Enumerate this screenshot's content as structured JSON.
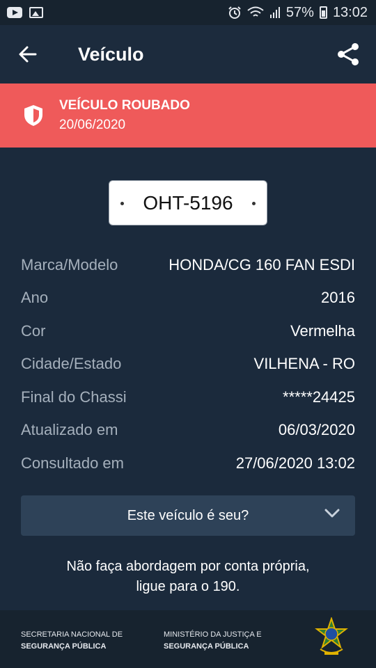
{
  "status_bar": {
    "battery": "57%",
    "time": "13:02"
  },
  "app_bar": {
    "title": "Veículo"
  },
  "alert": {
    "title": "VEÍCULO ROUBADO",
    "date": "20/06/2020"
  },
  "plate": "OHT-5196",
  "details": [
    {
      "label": "Marca/Modelo",
      "value": "HONDA/CG 160 FAN ESDI"
    },
    {
      "label": "Ano",
      "value": "2016"
    },
    {
      "label": "Cor",
      "value": "Vermelha"
    },
    {
      "label": "Cidade/Estado",
      "value": "VILHENA - RO"
    },
    {
      "label": "Final do Chassi",
      "value": "*****24425"
    },
    {
      "label": "Atualizado em",
      "value": "06/03/2020"
    },
    {
      "label": "Consultado em",
      "value": "27/06/2020 13:02"
    }
  ],
  "ownership_question": "Este veículo é seu?",
  "warning": {
    "line1": "Não faça abordagem por conta própria,",
    "line2": "ligue para o 190."
  },
  "footer": {
    "org1_line1": "SECRETARIA NACIONAL DE",
    "org1_line2": "SEGURANÇA PÚBLICA",
    "org2_line1": "MINISTÉRIO DA JUSTIÇA E",
    "org2_line2": "SEGURANÇA PÚBLICA"
  },
  "colors": {
    "background": "#1b2a3c",
    "alert": "#ef5a5a",
    "accordion": "#2e4258"
  }
}
